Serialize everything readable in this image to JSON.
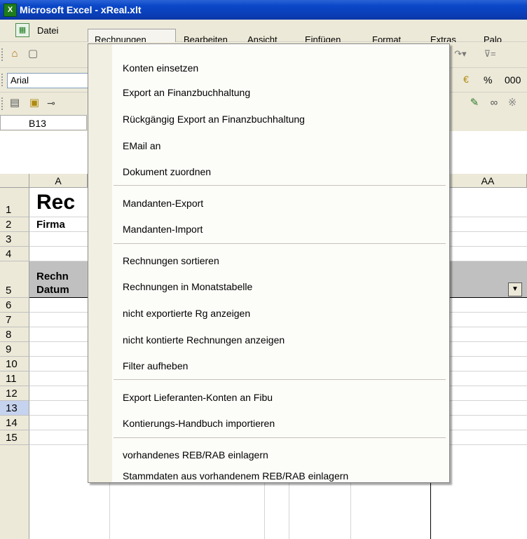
{
  "window": {
    "title": "Microsoft Excel - xReal.xlt"
  },
  "menubar": {
    "items": [
      "Datei",
      "Rechnungen",
      "Bearbeiten",
      "Ansicht",
      "Einfügen",
      "Format",
      "Extras",
      "Palo"
    ]
  },
  "toolbar": {
    "font_name": "Arial",
    "percent": "%",
    "thousands": "000"
  },
  "namebox": {
    "value": "B13"
  },
  "columns": [
    "A",
    "AA"
  ],
  "rows": [
    "1",
    "2",
    "3",
    "4",
    "5",
    "6",
    "7",
    "8",
    "9",
    "10",
    "11",
    "12",
    "13",
    "14",
    "15"
  ],
  "cells": {
    "a1": "Rec",
    "a2": "Firma",
    "a5_line1": "Rechn",
    "a5_line2": "Datum"
  },
  "dropdown": {
    "items": [
      "Konten einsetzen",
      "Export an Finanzbuchhaltung",
      "Rückgängig Export an Finanzbuchhaltung",
      "EMail an",
      "Dokument zuordnen",
      "Mandanten-Export",
      "Mandanten-Import",
      "Rechnungen sortieren",
      "Rechnungen in Monatstabelle",
      "nicht exportierte Rg anzeigen",
      "nicht kontierte Rechnungen anzeigen",
      "Filter aufheben",
      "Export Lieferanten-Konten an Fibu",
      "Kontierungs-Handbuch importieren",
      "vorhandenes REB/RAB einlagern",
      "Stammdaten aus vorhandenem REB/RAB einlagern"
    ]
  },
  "colors": {
    "titlebar": "#0a47c8",
    "chrome": "#ece9d8",
    "selected_row": "#c6d3ef"
  }
}
